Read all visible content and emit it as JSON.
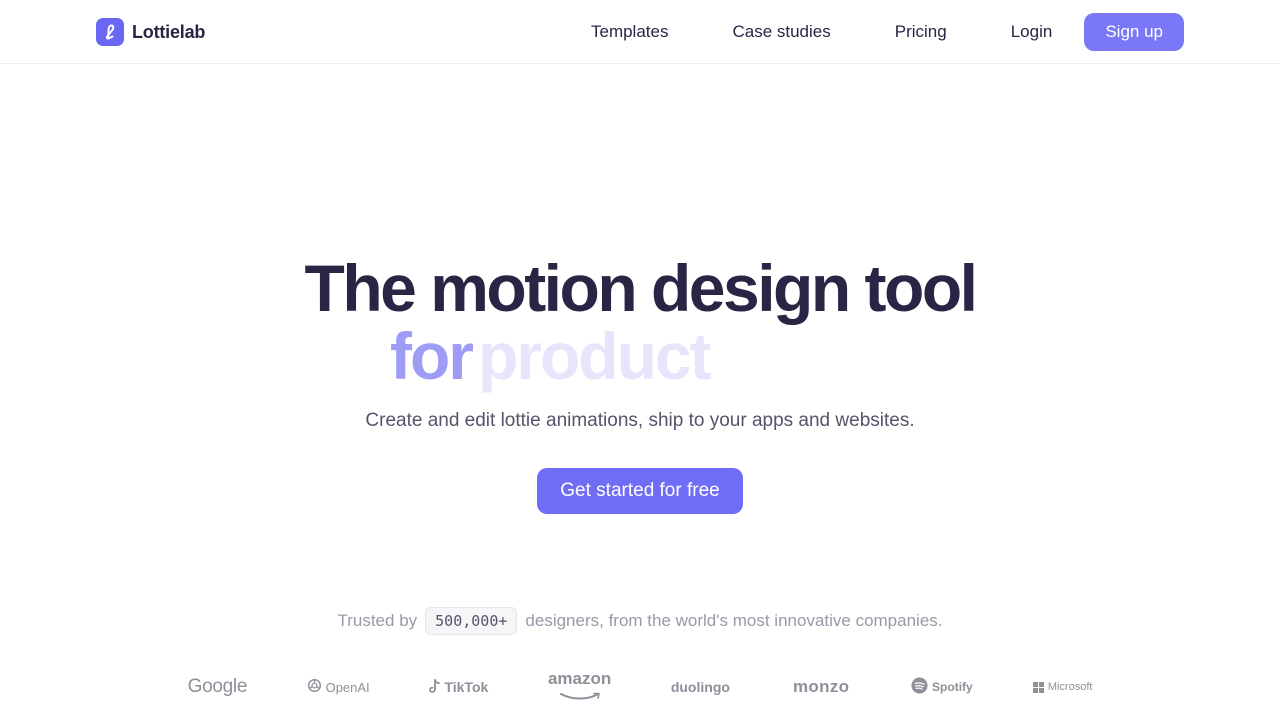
{
  "nav": {
    "brand": {
      "name": "Lottielab",
      "logo_icon": "lottielab-logo-icon",
      "accent": "#6b67f5"
    },
    "links": [
      {
        "label": "Templates"
      },
      {
        "label": "Case studies"
      },
      {
        "label": "Pricing"
      },
      {
        "label": "Login"
      }
    ],
    "signup_label": "Sign up"
  },
  "hero": {
    "title": "The motion design tool",
    "rotator_lead": "for",
    "rotator_word": "product",
    "subtitle": "Create and edit lottie animations, ship to your apps and websites.",
    "cta_label": "Get started for free"
  },
  "trust": {
    "prefix": "Trusted by",
    "count": "500,000+",
    "suffix": "designers, from the world's most innovative companies."
  },
  "logos": [
    {
      "name": "Google"
    },
    {
      "name": "OpenAI",
      "icon": "openai-icon"
    },
    {
      "name": "TikTok",
      "icon": "tiktok-icon"
    },
    {
      "name": "amazon",
      "icon": "amazon-smile-icon"
    },
    {
      "name": "duolingo"
    },
    {
      "name": "monzo"
    },
    {
      "name": "Spotify",
      "icon": "spotify-icon"
    },
    {
      "name": "Microsoft",
      "icon": "microsoft-icon"
    }
  ],
  "colors": {
    "primary": "#6f6cf6",
    "signup": "#7b78f7",
    "heading": "#2a2545",
    "rotator_lead": "#9e9cf5",
    "rotator_word": "#e6e5fb",
    "muted": "#9a99a8"
  }
}
